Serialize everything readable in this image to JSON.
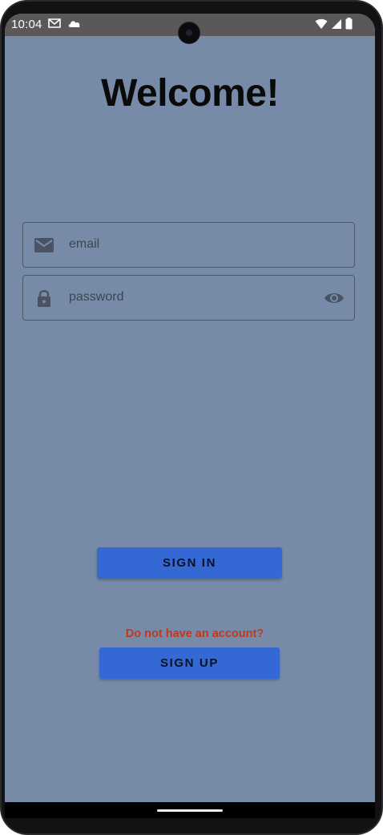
{
  "status_bar": {
    "time": "10:04",
    "left_icons": [
      "gmail-icon",
      "cloud-icon"
    ],
    "right_icons": [
      "wifi-icon",
      "signal-icon",
      "battery-icon"
    ]
  },
  "login": {
    "title": "Welcome!",
    "email": {
      "icon": "mail-icon",
      "placeholder": "email",
      "value": ""
    },
    "password": {
      "icon": "lock-icon",
      "placeholder": "password",
      "value": "",
      "toggle_icon": "eye-icon"
    },
    "sign_in_label": "SIGN IN",
    "no_account_prompt": "Do not have an account?",
    "sign_up_label": "SIGN UP"
  },
  "colors": {
    "background": "#778ba8",
    "button": "#3468d4",
    "prompt": "#c0391b",
    "status_bar": "#5b5858"
  }
}
